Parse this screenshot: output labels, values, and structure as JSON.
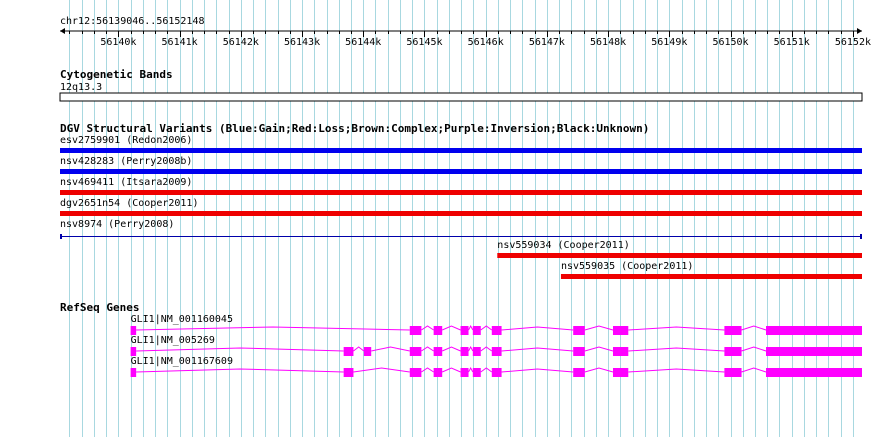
{
  "browser": {
    "locus": "chr12:56139046..56152148",
    "ruler": {
      "start": 56139046,
      "end": 56152148,
      "tick_labels": [
        "56140k",
        "56141k",
        "56142k",
        "56143k",
        "56144k",
        "56145k",
        "56146k",
        "56147k",
        "56148k",
        "56149k",
        "56150k",
        "56151k",
        "56152k"
      ]
    },
    "colors": {
      "grid": "#a8d8e0",
      "gain": "#0000ee",
      "loss": "#ee0000",
      "unknown": "#0000aa",
      "gene": "#ff00ff"
    }
  },
  "tracks": {
    "cytoband": {
      "title": "Cytogenetic Bands",
      "band": "12q13.3"
    },
    "dgv": {
      "title": "DGV Structural Variants (Blue:Gain;Red:Loss;Brown:Complex;Purple:Inversion;Black:Unknown)",
      "features": [
        {
          "label": "esv2759901 (Redon2006)",
          "type": "gain",
          "start": 56139046,
          "end": 56152148
        },
        {
          "label": "nsv428283 (Perry2008b)",
          "type": "gain",
          "start": 56139046,
          "end": 56152148
        },
        {
          "label": "nsv469411 (Itsara2009)",
          "type": "loss",
          "start": 56139046,
          "end": 56152148
        },
        {
          "label": "dgv2651n54 (Cooper2011)",
          "type": "loss",
          "start": 56139046,
          "end": 56152148
        },
        {
          "label": "nsv8974 (Perry2008)",
          "type": "unknown",
          "start": 56139046,
          "end": 56152148
        },
        {
          "label": "nsv559034 (Cooper2011)",
          "type": "loss",
          "start": 56146190,
          "end": 56152148
        },
        {
          "label": "nsv559035 (Cooper2011)",
          "type": "loss",
          "start": 56147230,
          "end": 56152148
        }
      ]
    },
    "refseq": {
      "title": "RefSeq Genes",
      "transcripts": [
        {
          "label": "GLI1|NM_001160045",
          "start": 56140200,
          "end": 56152148,
          "exons": [
            [
              56140200,
              56140290
            ],
            [
              56144760,
              56144950
            ],
            [
              56145150,
              56145290
            ],
            [
              56145590,
              56145720
            ],
            [
              56145790,
              56145920
            ],
            [
              56146100,
              56146260
            ],
            [
              56147430,
              56147620
            ],
            [
              56148080,
              56148330
            ],
            [
              56149900,
              56150180
            ],
            [
              56150580,
              56152148
            ]
          ]
        },
        {
          "label": "GLI1|NM_005269",
          "start": 56140200,
          "end": 56152148,
          "exons": [
            [
              56140200,
              56140290
            ],
            [
              56143680,
              56143840
            ],
            [
              56144010,
              56144130
            ],
            [
              56144760,
              56144950
            ],
            [
              56145150,
              56145290
            ],
            [
              56145590,
              56145720
            ],
            [
              56145790,
              56145920
            ],
            [
              56146100,
              56146260
            ],
            [
              56147430,
              56147620
            ],
            [
              56148080,
              56148330
            ],
            [
              56149900,
              56150180
            ],
            [
              56150580,
              56152148
            ]
          ]
        },
        {
          "label": "GLI1|NM_001167609",
          "start": 56140200,
          "end": 56152148,
          "exons": [
            [
              56140200,
              56140290
            ],
            [
              56143680,
              56143840
            ],
            [
              56144760,
              56144950
            ],
            [
              56145150,
              56145290
            ],
            [
              56145590,
              56145720
            ],
            [
              56145790,
              56145920
            ],
            [
              56146100,
              56146260
            ],
            [
              56147430,
              56147620
            ],
            [
              56148080,
              56148330
            ],
            [
              56149900,
              56150180
            ],
            [
              56150580,
              56152148
            ]
          ]
        }
      ]
    }
  }
}
